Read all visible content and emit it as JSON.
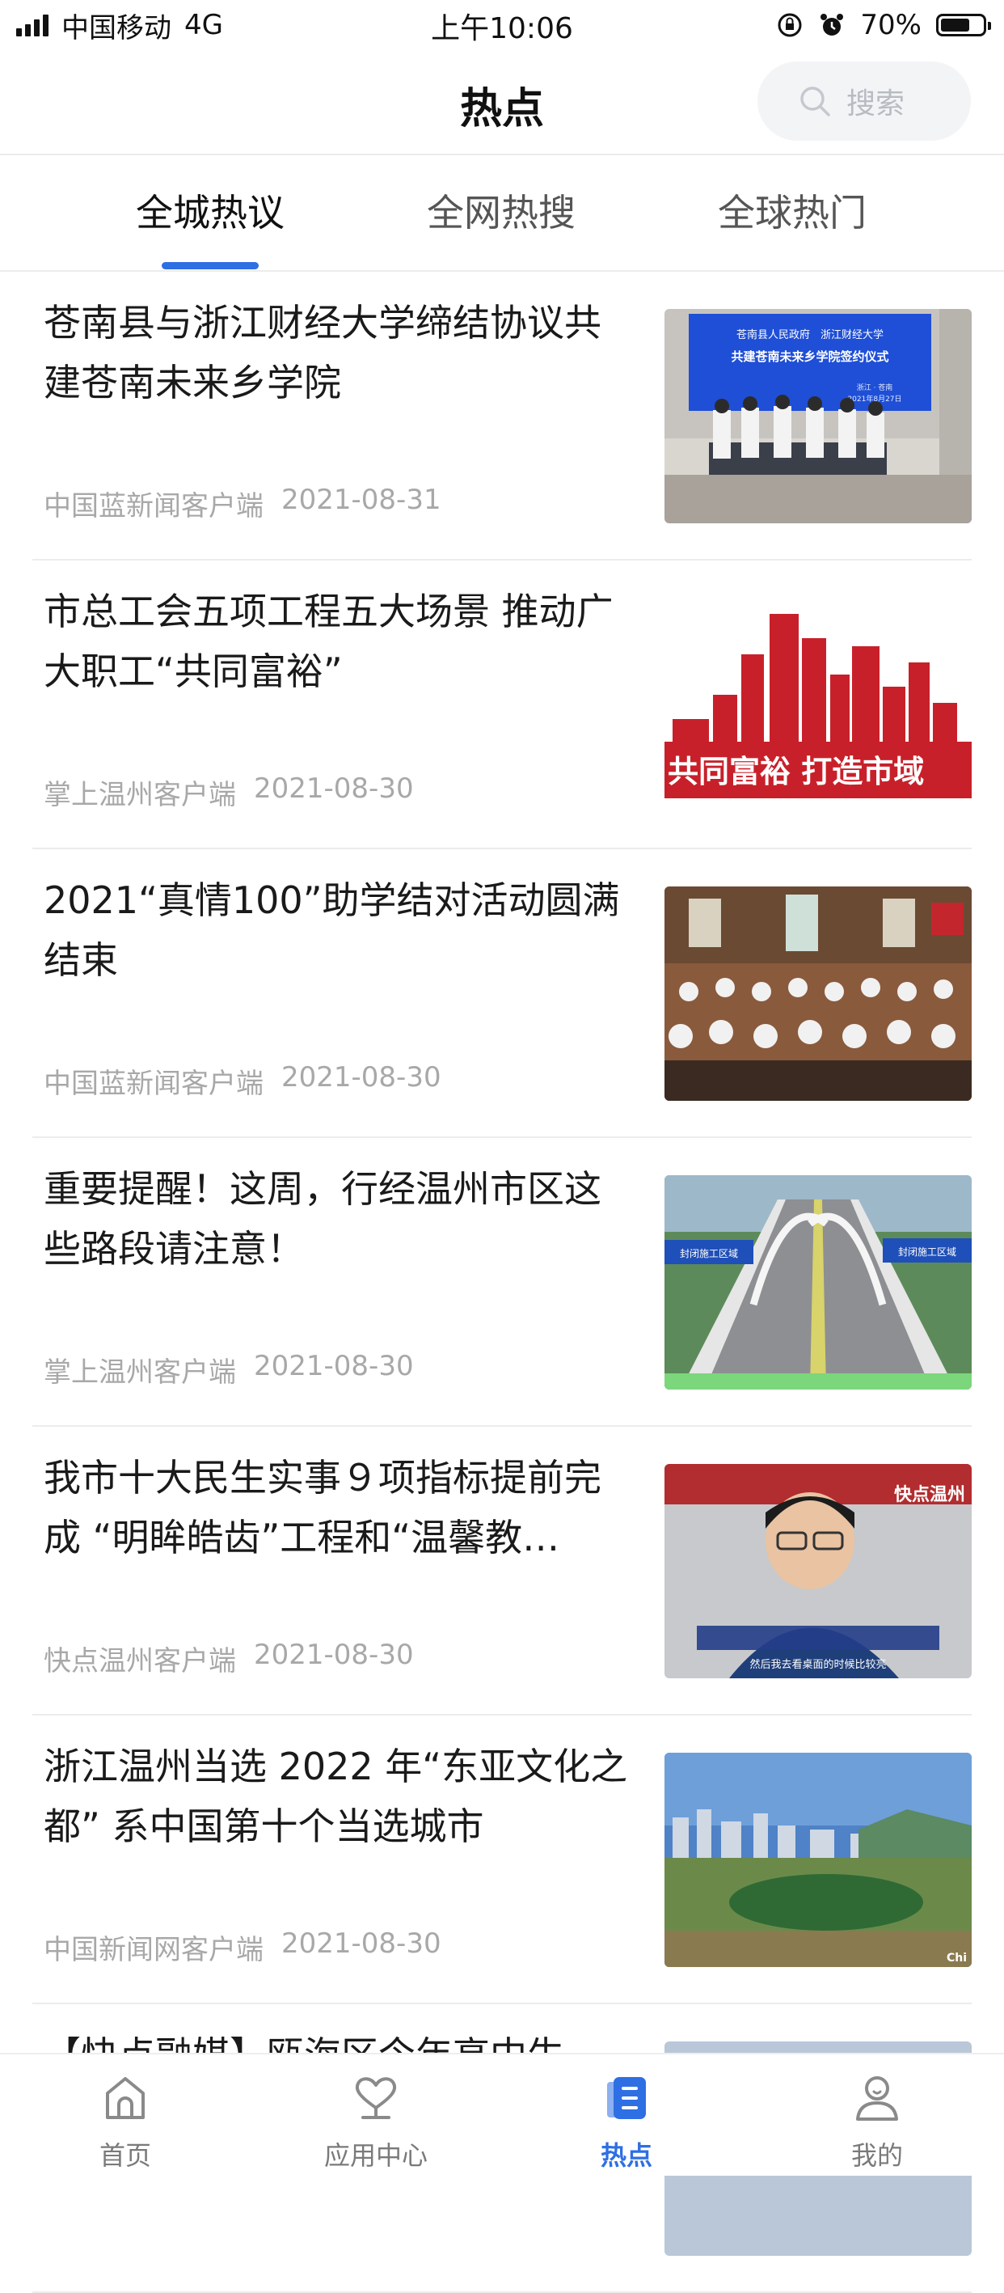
{
  "status_bar": {
    "carrier": "中国移动",
    "network": "4G",
    "time": "上午10:06",
    "battery": "70%",
    "battery_level": 0.7
  },
  "header": {
    "title": "热点",
    "search_placeholder": "搜索"
  },
  "tabs": [
    {
      "label": "全城热议",
      "active": true
    },
    {
      "label": "全网热搜",
      "active": false
    },
    {
      "label": "全球热门",
      "active": false
    }
  ],
  "news": [
    {
      "title": "苍南县与浙江财经大学缔结协议共建苍南未来乡学院",
      "source": "中国蓝新闻客户端",
      "date": "2021-08-31",
      "thumb": {
        "banner_line1": "苍南县人民政府　浙江财经大学",
        "banner_line2": "共建苍南未来乡学院签约仪式",
        "banner_line3": "浙江 · 苍南",
        "banner_date": "2021年8月27日"
      }
    },
    {
      "title": "市总工会五项工程五大场景 推动广大职工“共同富裕”",
      "source": "掌上温州客户端",
      "date": "2021-08-30",
      "thumb": {
        "caption": "共同富裕  打造市域"
      }
    },
    {
      "title": "2021“真情100”助学结对活动圆满结束",
      "source": "中国蓝新闻客户端",
      "date": "2021-08-30",
      "thumb": {}
    },
    {
      "title": "重要提醒！这周，行经温州市区这些路段请注意！",
      "source": "掌上温州客户端",
      "date": "2021-08-30",
      "thumb": {
        "label_left": "封闭施工区域",
        "label_right": "封闭施工区域"
      }
    },
    {
      "title": "我市十大民生实事９项指标提前完成 “明眸皓齿”工程和“温馨教…",
      "source": "快点温州客户端",
      "date": "2021-08-30",
      "thumb": {
        "corner_text": "快点温州",
        "subtitle": "然后我去看桌面的时候比较亮"
      }
    },
    {
      "title": "浙江温州当选 2022 年“东亚文化之都” 系中国第十个当选城市",
      "source": "中国新闻网客户端",
      "date": "2021-08-30",
      "thumb": {
        "corner_text": "Chi"
      }
    },
    {
      "title": "【快点融媒】瓯海区今年高中生",
      "source": "",
      "date": "",
      "thumb": {}
    }
  ],
  "tab_bar": [
    {
      "label": "首页",
      "icon": "home-icon",
      "active": false
    },
    {
      "label": "应用中心",
      "icon": "heart-icon",
      "active": false
    },
    {
      "label": "热点",
      "icon": "news-icon",
      "active": true
    },
    {
      "label": "我的",
      "icon": "user-icon",
      "active": false
    }
  ],
  "colors": {
    "accent": "#2f6fe4",
    "divider": "#ececec",
    "meta": "#a8a8a8"
  }
}
